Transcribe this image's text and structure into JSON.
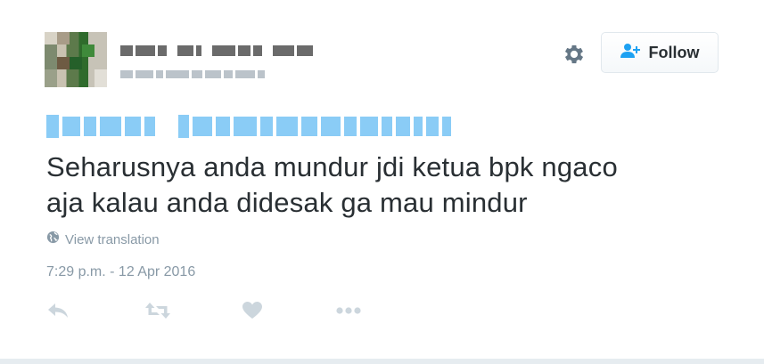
{
  "tweet": {
    "text_lines": [
      "Seharusnya anda mundur jdi ketua bpk ngaco",
      "aja kalau anda didesak ga mau mindur"
    ],
    "translate_label": "View translation",
    "timestamp": "7:29 p.m. - 12 Apr 2016"
  },
  "header": {
    "follow_label": "Follow"
  },
  "icons": {
    "settings": "gear-icon",
    "follow": "add-user-icon",
    "globe": "globe-icon",
    "reply": "reply-icon",
    "retweet": "retweet-icon",
    "like": "heart-icon",
    "more": "more-icon"
  },
  "colors": {
    "text": "#292f33",
    "muted": "#8899a6",
    "icon": "#ccd6dd",
    "link": "#2aa3ef",
    "follow_icon": "#1da1f2"
  }
}
